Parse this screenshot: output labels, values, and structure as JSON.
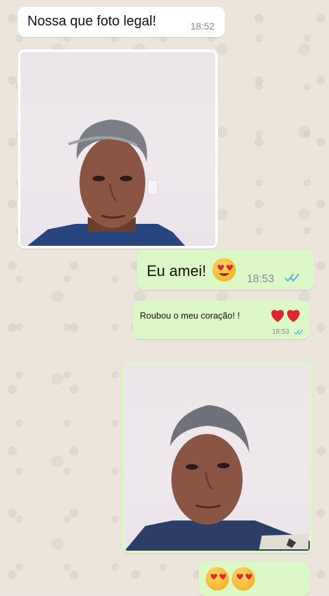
{
  "chat": {
    "messages": [
      {
        "direction": "incoming",
        "text": "Nossa que foto legal!",
        "time": "18:52"
      },
      {
        "direction": "incoming",
        "type": "photo"
      },
      {
        "direction": "outgoing",
        "text": "Eu amei!",
        "emoji": "smiling-face-with-heart-eyes",
        "time": "18:53",
        "status": "read"
      },
      {
        "direction": "outgoing",
        "text": "Roubou o meu coração! !",
        "emoji": "two-red-hearts",
        "time": "18:53",
        "status": "read"
      },
      {
        "direction": "outgoing",
        "type": "photo"
      },
      {
        "direction": "outgoing",
        "emoji": "two-heart-eyes-faces"
      }
    ]
  },
  "colors": {
    "incoming_bubble": "#ffffff",
    "outgoing_bubble": "#dcf8c6",
    "read_ticks": "#4fb6ec",
    "wallpaper": "#ece5dd"
  }
}
